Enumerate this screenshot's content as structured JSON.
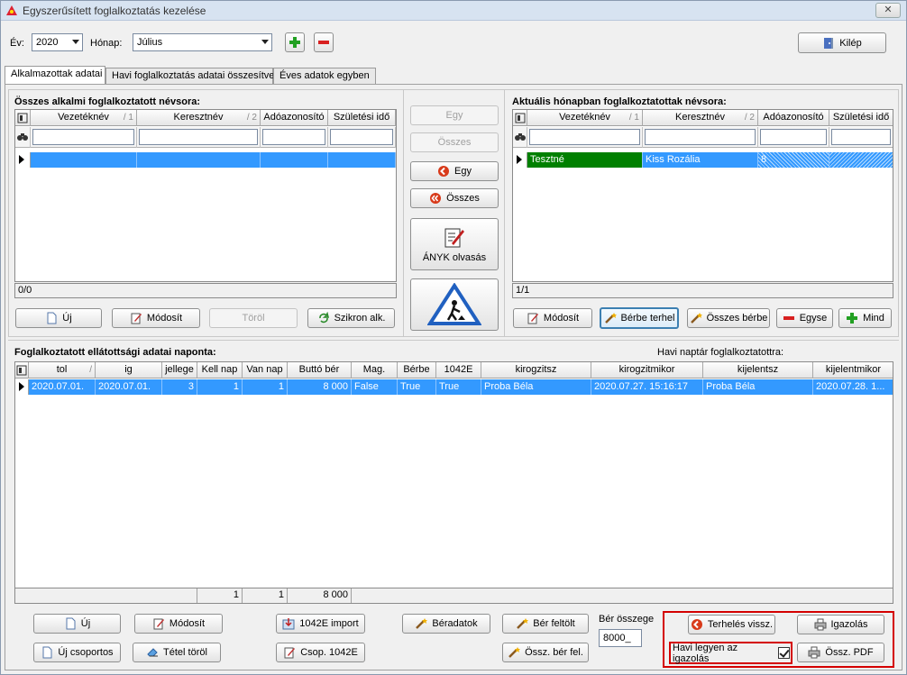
{
  "window": {
    "title": "Egyszerűsített foglalkoztatás kezelése",
    "close_label": "✕"
  },
  "toolbar": {
    "year_label": "Év:",
    "year_value": "2020",
    "month_label": "Hónap:",
    "month_value": "Július",
    "exit_label": "Kilép"
  },
  "tabs": [
    {
      "label": "Alkalmazottak adatai",
      "active": true
    },
    {
      "label": "Havi foglalkoztatás adatai összesítve",
      "active": false
    },
    {
      "label": "Éves adatok egyben",
      "active": false
    }
  ],
  "left_panel": {
    "title": "Összes alkalmi foglalkoztatott névsora:",
    "columns": [
      {
        "label": "Vezetéknév",
        "sort": "/ 1"
      },
      {
        "label": "Keresztnév",
        "sort": "/ 2"
      },
      {
        "label": "Adóazonosító",
        "sort": ""
      },
      {
        "label": "Születési idő",
        "sort": ""
      }
    ],
    "status": "0/0",
    "buttons": {
      "new": "Új",
      "modify": "Módosít",
      "delete": "Töröl",
      "sync": "Szikron alk."
    }
  },
  "middle": {
    "one": "Egy",
    "all": "Összes",
    "back_one": "Egy",
    "back_all": "Összes",
    "anyk": "ÁNYK olvasás"
  },
  "right_panel": {
    "title": "Aktuális hónapban foglalkoztatottak névsora:",
    "columns": [
      {
        "label": "Vezetéknév",
        "sort": "/ 1"
      },
      {
        "label": "Keresztnév",
        "sort": "/ 2"
      },
      {
        "label": "Adóazonosító",
        "sort": ""
      },
      {
        "label": "Születési idő",
        "sort": ""
      }
    ],
    "rows": [
      {
        "vezeteknev": "Tesztné",
        "keresztnev": "Kiss Rozália",
        "adoazonosito": "8",
        "szuletesi_ido": ""
      }
    ],
    "status": "1/1",
    "buttons": {
      "modify": "Módosít",
      "lend": "Bérbe terhel",
      "lend_all": "Összes bérbe",
      "one": "Egyse",
      "all": "Mind"
    }
  },
  "bottom": {
    "title": "Foglalkoztatott ellátottsági adatai naponta:",
    "calendar_label": "Havi naptár foglalkoztatottra:",
    "columns": [
      "tol",
      "ig",
      "jellege",
      "Kell nap",
      "Van nap",
      "Buttó bér",
      "Mag.",
      "Bérbe",
      "1042E",
      "kirogzitsz",
      "kirogzitmikor",
      "kijelentsz",
      "kijelentmikor"
    ],
    "rows": [
      [
        "2020.07.01.",
        "2020.07.01.",
        "3",
        "1",
        "1",
        "8 000",
        "False",
        "True",
        "True",
        "Proba Béla",
        "2020.07.27. 15:16:17",
        "Proba Béla",
        "2020.07.28. 1..."
      ]
    ],
    "footer": {
      "kell": "1",
      "van": "1",
      "ber": "8 000"
    },
    "buttons": {
      "new": "Új",
      "modify": "Módosít",
      "import": "1042E import",
      "payroll": "Béradatok",
      "upload": "Bér feltölt",
      "new_group": "Új csoportos",
      "delete_item": "Tétel töröl",
      "group": "Csop. 1042E",
      "sum_upload": "Össz. bér fel.",
      "revert": "Terhelés vissz.",
      "cert": "Igazolás",
      "sum_pdf": "Össz. PDF"
    },
    "wage_sum_label": "Bér összege",
    "wage_sum_value": "8000_",
    "monthly_cert_label": "Havi legyen az igazolás",
    "monthly_cert_checked": true
  },
  "colors": {
    "selection": "#3399ff",
    "green_cell": "#008000",
    "highlight_box": "#d40000"
  }
}
